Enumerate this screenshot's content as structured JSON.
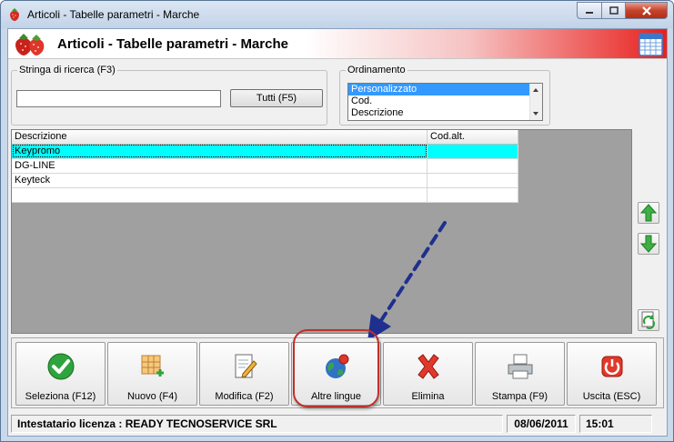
{
  "window": {
    "title": "Articoli - Tabelle parametri - Marche"
  },
  "header": {
    "title": "Articoli - Tabelle parametri - Marche"
  },
  "search": {
    "legend": "Stringa di ricerca (F3)",
    "value": "",
    "all_button": "Tutti (F5)"
  },
  "ordering": {
    "legend": "Ordinamento",
    "options": [
      "Personalizzato",
      "Cod.",
      "Descrizione"
    ],
    "selected": "Personalizzato"
  },
  "grid": {
    "columns": [
      "Descrizione",
      "Cod.alt."
    ],
    "rows": [
      {
        "descrizione": "Keypromo",
        "cod_alt": ""
      },
      {
        "descrizione": "DG-LINE",
        "cod_alt": ""
      },
      {
        "descrizione": "Keyteck",
        "cod_alt": ""
      },
      {
        "descrizione": "",
        "cod_alt": ""
      }
    ],
    "selected_row": 0
  },
  "toolbar": {
    "buttons": [
      {
        "label": "Seleziona (F12)",
        "icon": "checkmark-icon"
      },
      {
        "label": "Nuovo (F4)",
        "icon": "new-grid-icon"
      },
      {
        "label": "Modifica (F2)",
        "icon": "edit-document-icon"
      },
      {
        "label": "Altre lingue",
        "icon": "globe-icon"
      },
      {
        "label": "Elimina",
        "icon": "delete-x-icon"
      },
      {
        "label": "Stampa (F9)",
        "icon": "printer-icon"
      },
      {
        "label": "Uscita (ESC)",
        "icon": "power-icon"
      }
    ]
  },
  "status": {
    "license": "Intestatario licenza : READY TECNOSERVICE SRL",
    "date": "08/06/2011",
    "time": "15:01"
  },
  "colors": {
    "accent_red": "#e8201d",
    "selection_cyan": "#00ffff",
    "list_selection": "#3399ff",
    "annotation_arrow": "#1f2f8f",
    "highlight_ring": "#c0302a"
  }
}
